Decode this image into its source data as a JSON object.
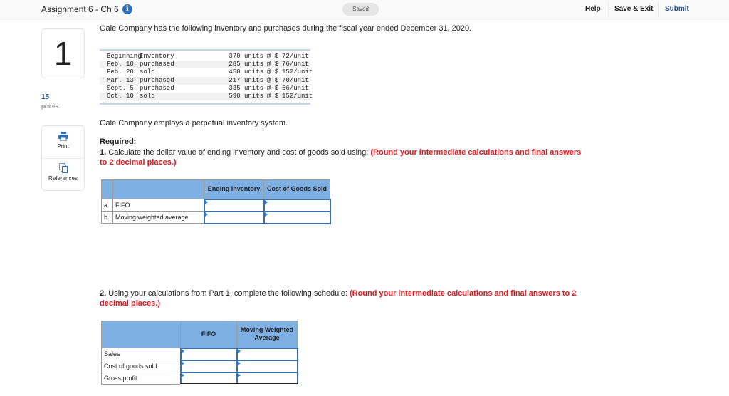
{
  "header": {
    "title": "Assignment 6 - Ch 6",
    "info_icon": "info-icon",
    "saved_status": "Saved",
    "help_label": "Help",
    "save_exit_label": "Save & Exit",
    "submit_label": "Submit"
  },
  "sidebar": {
    "question_number": "1",
    "points_value": "15",
    "points_label": "points",
    "tools": [
      {
        "label": "Print",
        "icon": "printer-icon"
      },
      {
        "label": "References",
        "icon": "references-icon"
      }
    ]
  },
  "question": {
    "intro": "Gale Company has the following inventory and purchases during the fiscal year ended December 31, 2020.",
    "inventory_rows": [
      {
        "date": "Beginning",
        "desc": "Inventory",
        "units": "370 units",
        "at": "@ $",
        "cost": "72/unit"
      },
      {
        "date": "Feb. 10",
        "desc": "purchased",
        "units": "285 units",
        "at": "@ $",
        "cost": "76/unit"
      },
      {
        "date": "Feb. 20",
        "desc": "sold",
        "units": "450 units",
        "at": "@ $",
        "cost": "152/unit"
      },
      {
        "date": "Mar. 13",
        "desc": "purchased",
        "units": "217 units",
        "at": "@ $",
        "cost": "70/unit"
      },
      {
        "date": "Sept. 5",
        "desc": "purchased",
        "units": "335 units",
        "at": "@ $",
        "cost": "56/unit"
      },
      {
        "date": "Oct. 10",
        "desc": "sold",
        "units": "590 units",
        "at": "@ $",
        "cost": "152/unit"
      }
    ],
    "perpetual_text": "Gale Company employs a perpetual inventory system.",
    "required_label": "Required:",
    "part1_number": "1.",
    "part1_text": " Calculate the dollar value of ending inventory and cost of goods sold using: ",
    "part1_note": "(Round your intermediate calculations and final answers to 2 decimal places.)",
    "part2_number": "2.",
    "part2_text": " Using your calculations from Part 1, complete the following schedule: ",
    "part2_note": "(Round your intermediate calculations and final answers to 2 decimal places.)"
  },
  "table1": {
    "headers": [
      "",
      "",
      "Ending Inventory",
      "Cost of Goods Sold"
    ],
    "rows": [
      {
        "letter": "a.",
        "label": "FIFO",
        "ending_inventory": "",
        "cogs": ""
      },
      {
        "letter": "b.",
        "label": "Moving weighted average",
        "ending_inventory": "",
        "cogs": ""
      }
    ]
  },
  "table2": {
    "headers": [
      "",
      "FIFO",
      "Moving Weighted Average"
    ],
    "rows": [
      {
        "label": "Sales",
        "fifo": "",
        "mwa": ""
      },
      {
        "label": "Cost of goods sold",
        "fifo": "",
        "mwa": ""
      },
      {
        "label": "Gross profit",
        "fifo": "",
        "mwa": ""
      }
    ]
  }
}
